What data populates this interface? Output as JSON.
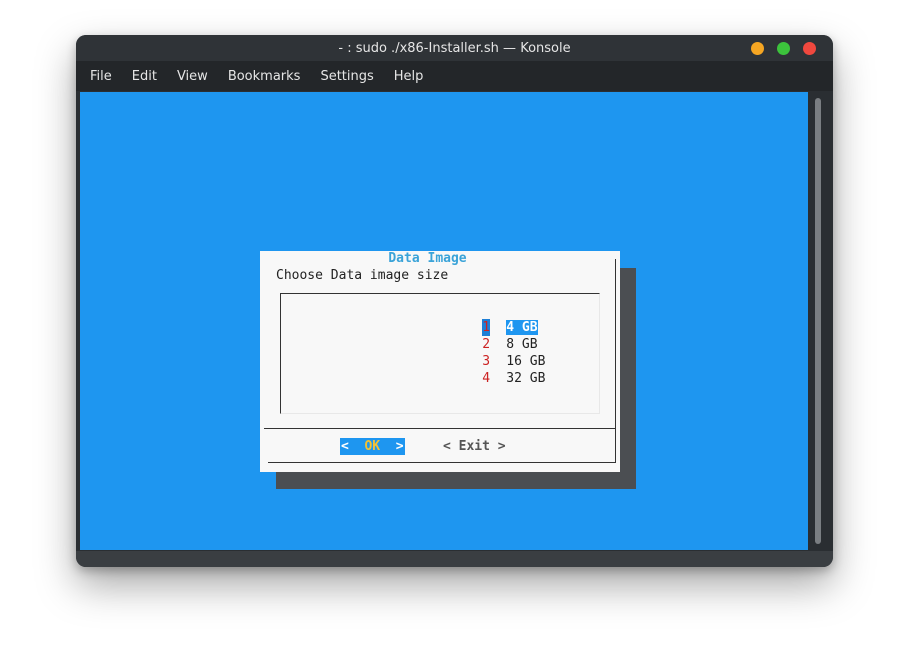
{
  "window": {
    "title": "- : sudo ./x86-Installer.sh — Konsole",
    "controls": {
      "minimize_color": "#f5a623",
      "maximize_color": "#3cc33c",
      "close_color": "#f0483e"
    }
  },
  "menubar": {
    "items": [
      "File",
      "Edit",
      "View",
      "Bookmarks",
      "Settings",
      "Help"
    ]
  },
  "terminal": {
    "background": "#1e96f0"
  },
  "dialog": {
    "title": "Data Image",
    "prompt": "Choose Data image size",
    "options": [
      {
        "tag": "1",
        "label": "4 GB",
        "selected": true
      },
      {
        "tag": "2",
        "label": "8 GB",
        "selected": false
      },
      {
        "tag": "3",
        "label": "16 GB",
        "selected": false
      },
      {
        "tag": "4",
        "label": "32 GB",
        "selected": false
      }
    ],
    "buttons": {
      "ok_left": "<",
      "ok_label": "OK",
      "ok_right": ">",
      "exit": "< Exit >"
    }
  }
}
